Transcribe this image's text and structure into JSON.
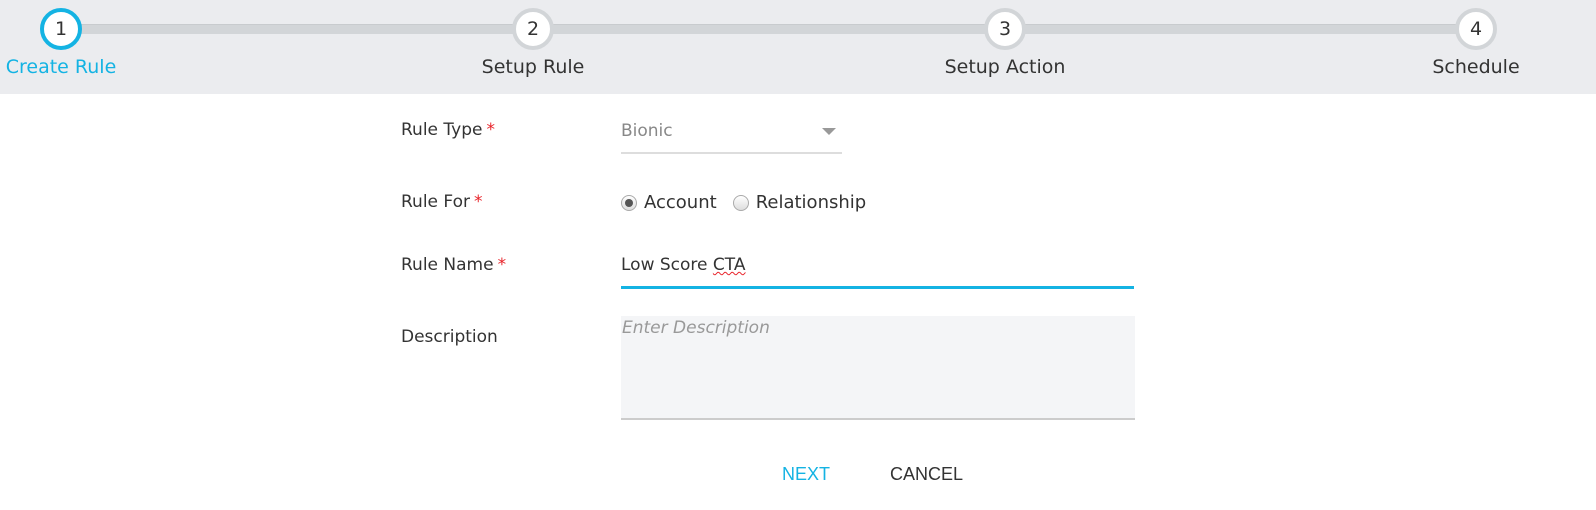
{
  "stepper": {
    "steps": [
      {
        "number": "1",
        "label": "Create Rule",
        "active": true
      },
      {
        "number": "2",
        "label": "Setup Rule",
        "active": false
      },
      {
        "number": "3",
        "label": "Setup Action",
        "active": false
      },
      {
        "number": "4",
        "label": "Schedule",
        "active": false
      }
    ]
  },
  "form": {
    "rule_type": {
      "label": "Rule Type",
      "required": "*",
      "value": "Bionic"
    },
    "rule_for": {
      "label": "Rule For",
      "required": "*",
      "options": [
        "Account",
        "Relationship"
      ],
      "selected": "Account"
    },
    "rule_name": {
      "label": "Rule Name",
      "required": "*",
      "value_prefix": "Low Score ",
      "value_misspelled": "CTA"
    },
    "description": {
      "label": "Description",
      "placeholder": "Enter Description"
    }
  },
  "actions": {
    "next": "NEXT",
    "cancel": "CANCEL"
  },
  "colors": {
    "accent": "#14b3e3",
    "required": "#e8232a"
  }
}
